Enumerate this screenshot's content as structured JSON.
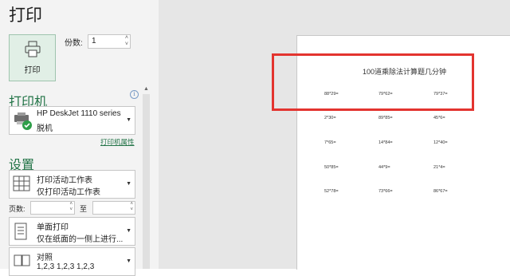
{
  "title": "打印",
  "print_button": {
    "label": "打印",
    "icon": "printer-icon"
  },
  "copies": {
    "label": "份数:",
    "value": "1"
  },
  "printer_section": {
    "heading": "打印机",
    "name": "HP DeskJet 1110 series",
    "status": "脱机",
    "properties_link": "打印机属性",
    "info_icon": "info-icon"
  },
  "settings_section": {
    "heading": "设置",
    "print_what": {
      "line1": "打印活动工作表",
      "line2": "仅打印活动工作表"
    },
    "pages": {
      "label": "页数:",
      "to_label": "至",
      "from_value": "",
      "to_value": ""
    },
    "sides": {
      "line1": "单面打印",
      "line2": "仅在纸面的一侧上进行..."
    },
    "collate": {
      "line1": "对照",
      "line2": "1,2,3    1,2,3    1,2,3"
    }
  },
  "preview": {
    "sheet_title": "100道乘除法计算题几分钟",
    "rows": [
      [
        "88*29=",
        "79*62=",
        "79*37="
      ],
      [
        "2*30=",
        "89*85=",
        "45*6="
      ],
      [
        "7*65=",
        "14*84=",
        "12*40="
      ],
      [
        "50*85=",
        "44*9=",
        "21*4="
      ],
      [
        "52*78=",
        "73*66=",
        "86*67="
      ]
    ]
  },
  "colors": {
    "accent": "#217346",
    "highlight": "#e3342f",
    "print_button_bg": "#e1efe6"
  }
}
